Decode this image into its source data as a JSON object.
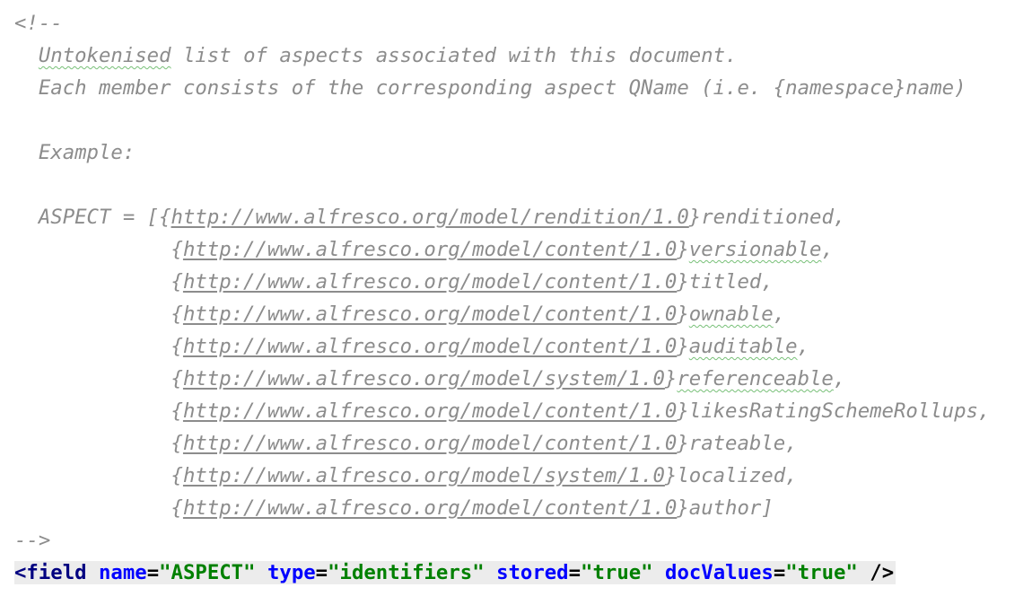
{
  "comment_open": "<!--",
  "comment_close": "-->",
  "intro_line_1_word": "Untokenised",
  "intro_line_1_rest": " list of aspects associated with this document.",
  "intro_line_2": "Each member consists of the corresponding aspect QName (i.e. {namespace}name)",
  "example_label": "Example:",
  "aspect_prefix": "ASPECT = [",
  "aspects": [
    {
      "url": "http://www.alfresco.org/model/rendition/1.0",
      "name": "renditioned",
      "suffix": ","
    },
    {
      "url": "http://www.alfresco.org/model/content/1.0",
      "name": "versionable",
      "suffix": ","
    },
    {
      "url": "http://www.alfresco.org/model/content/1.0",
      "name": "titled",
      "suffix": ","
    },
    {
      "url": "http://www.alfresco.org/model/content/1.0",
      "name": "ownable",
      "suffix": ","
    },
    {
      "url": "http://www.alfresco.org/model/content/1.0",
      "name": "auditable",
      "suffix": ","
    },
    {
      "url": "http://www.alfresco.org/model/system/1.0",
      "name": "referenceable",
      "suffix": ","
    },
    {
      "url": "http://www.alfresco.org/model/content/1.0",
      "name": "likesRatingSchemeRollups",
      "suffix": ","
    },
    {
      "url": "http://www.alfresco.org/model/content/1.0",
      "name": "rateable",
      "suffix": ","
    },
    {
      "url": "http://www.alfresco.org/model/system/1.0",
      "name": "localized",
      "suffix": ","
    },
    {
      "url": "http://www.alfresco.org/model/content/1.0",
      "name": "author",
      "suffix": "]"
    }
  ],
  "xml": {
    "open": "<field",
    "name_attr": "name",
    "name_val": "\"ASPECT\"",
    "type_attr": "type",
    "type_val": "\"identifiers\"",
    "stored_attr": "stored",
    "stored_val": "\"true\"",
    "docvalues_attr": "docValues",
    "docvalues_val": "\"true\"",
    "close": "/>"
  }
}
